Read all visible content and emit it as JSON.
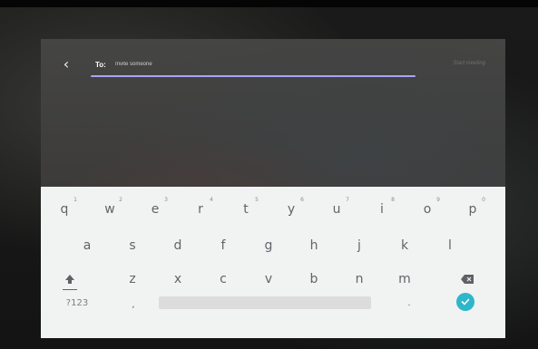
{
  "header": {
    "back_glyph": "‹",
    "to_label": "To:",
    "search_placeholder": "Invite someone",
    "start_meeting_label": "Start meeting"
  },
  "keyboard": {
    "row1": [
      {
        "key": "q",
        "hint": "1"
      },
      {
        "key": "w",
        "hint": "2"
      },
      {
        "key": "e",
        "hint": "3"
      },
      {
        "key": "r",
        "hint": "4"
      },
      {
        "key": "t",
        "hint": "5"
      },
      {
        "key": "y",
        "hint": "6"
      },
      {
        "key": "u",
        "hint": "7"
      },
      {
        "key": "i",
        "hint": "8"
      },
      {
        "key": "o",
        "hint": "9"
      },
      {
        "key": "p",
        "hint": "0"
      }
    ],
    "row2": [
      "a",
      "s",
      "d",
      "f",
      "g",
      "h",
      "j",
      "k",
      "l"
    ],
    "row3": [
      "z",
      "x",
      "c",
      "v",
      "b",
      "n",
      "m"
    ],
    "symbols_label": "?123",
    "comma_label": ",",
    "period_label": "."
  },
  "colors": {
    "underline_accent": "#a9a3ff",
    "enter_key": "#2eb6c9"
  },
  "icons": {
    "back": "chevron-left-icon",
    "shift": "shift-arrow-icon",
    "backspace": "backspace-icon",
    "enter": "checkmark-icon"
  }
}
